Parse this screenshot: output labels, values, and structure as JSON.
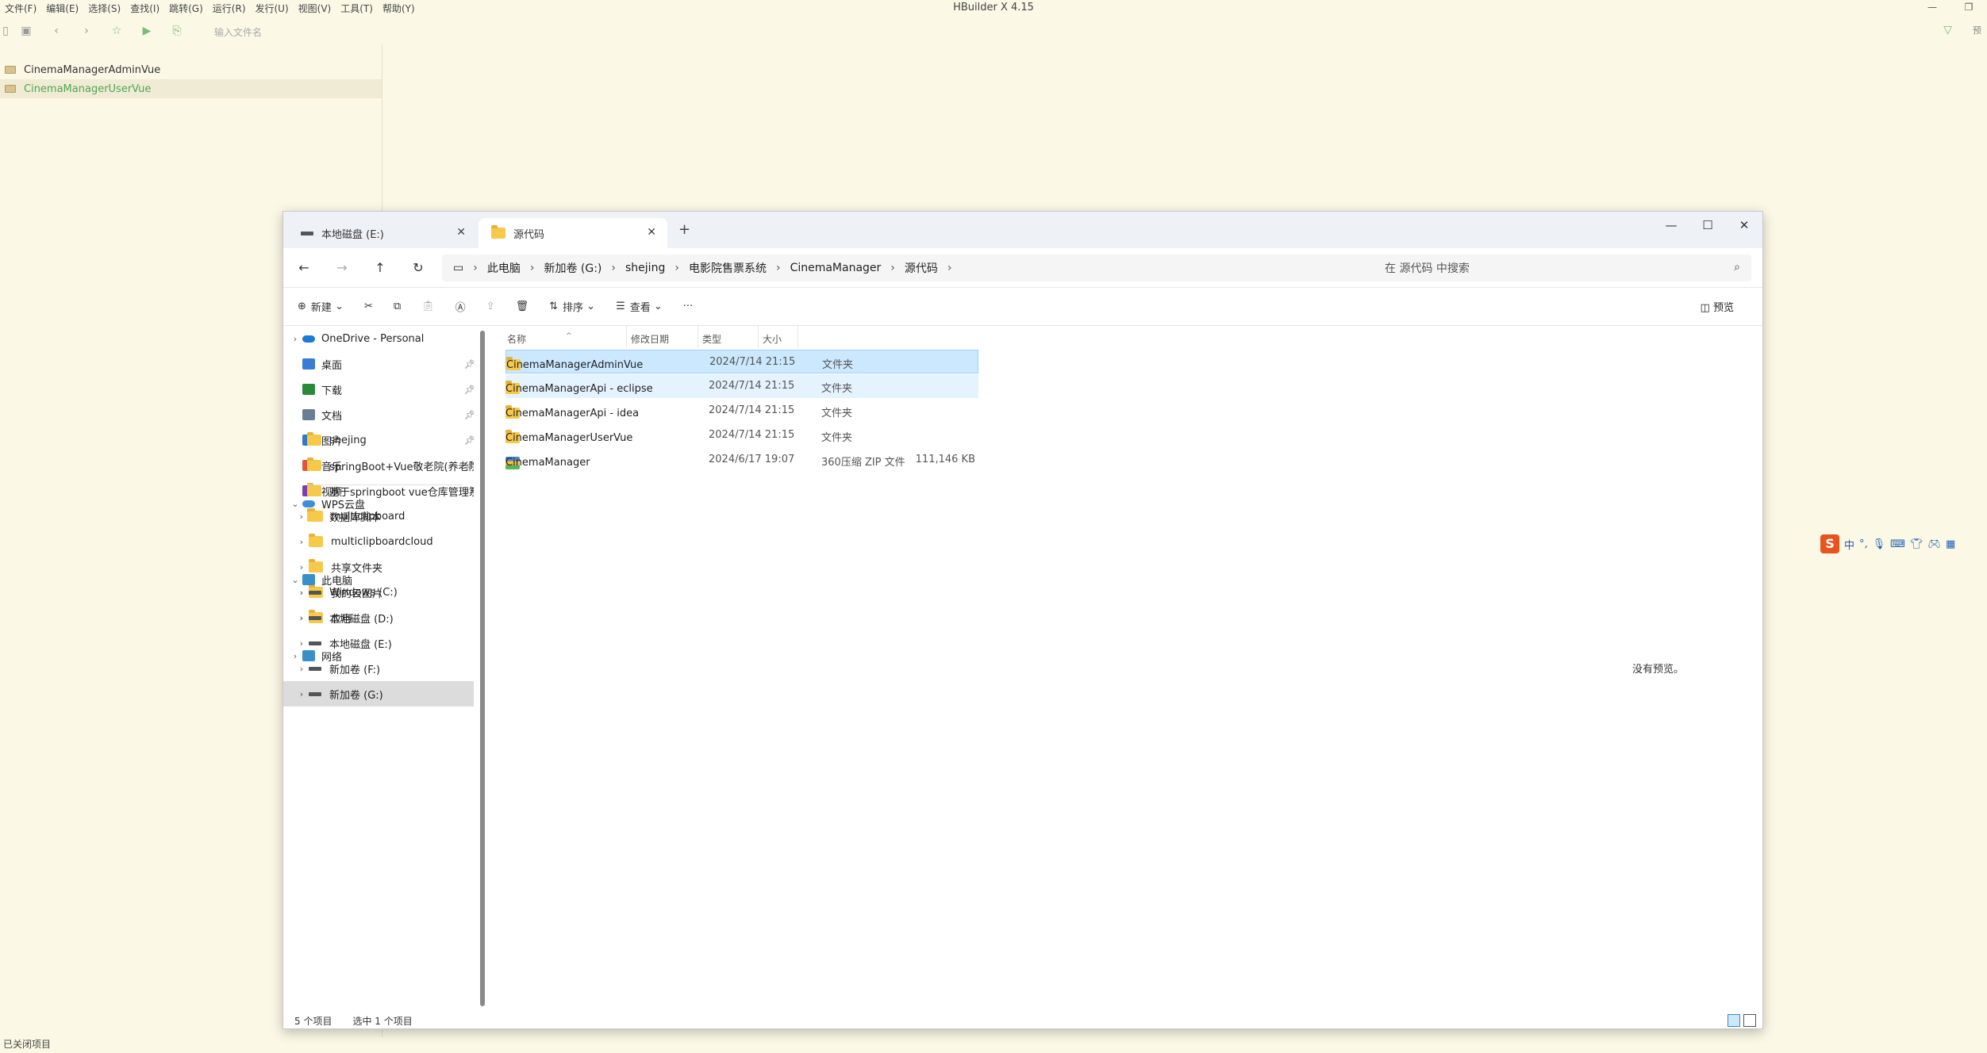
{
  "hbuilder": {
    "title": "HBuilder X 4.15",
    "menu": [
      "文件(F)",
      "编辑(E)",
      "选择(S)",
      "查找(I)",
      "跳转(G)",
      "运行(R)",
      "发行(U)",
      "视图(V)",
      "工具(T)",
      "帮助(Y)"
    ],
    "file_input_placeholder": "输入文件名",
    "preview_edge": "预",
    "projects": [
      "CinemaManagerAdminVue",
      "CinemaManagerUserVue"
    ],
    "status": "已关闭项目"
  },
  "explorer": {
    "tabs": [
      {
        "label": "本地磁盘 (E:)",
        "icon": "drive-icon"
      },
      {
        "label": "源代码",
        "icon": "folder-icon"
      }
    ],
    "breadcrumb": [
      "此电脑",
      "新加卷 (G:)",
      "shejing",
      "电影院售票系统",
      "CinemaManager",
      "源代码"
    ],
    "search_placeholder": "在 源代码 中搜索",
    "commands": {
      "new": "新建",
      "sort": "排序",
      "view": "查看",
      "more": "···",
      "preview": "预览"
    },
    "nav": {
      "onedrive": "OneDrive - Personal",
      "quick": [
        {
          "label": "桌面",
          "icon": "desktop-icon",
          "color": "#3a7bd5"
        },
        {
          "label": "下载",
          "icon": "download-icon",
          "color": "#2a8a3a"
        },
        {
          "label": "文档",
          "icon": "document-icon",
          "color": "#6a7f95"
        },
        {
          "label": "图片",
          "icon": "picture-icon",
          "color": "#2f79c6"
        },
        {
          "label": "音乐",
          "icon": "music-icon",
          "color": "#e0553a"
        },
        {
          "label": "视频",
          "icon": "video-icon",
          "color": "#7b3fb3"
        }
      ],
      "folders": [
        "shejing",
        "springBoot+Vue敬老院(养老院)管",
        "基于springboot vue仓库管理系统",
        "数据库脚本"
      ],
      "wps": "WPS云盘",
      "wps_items": [
        "multiclipboard",
        "multiclipboardcloud",
        "共享文件夹",
        "我的云图片",
        "应用"
      ],
      "pc": "此电脑",
      "drives": [
        "Windows (C:)",
        "本地磁盘 (D:)",
        "本地磁盘 (E:)",
        "新加卷 (F:)",
        "新加卷 (G:)"
      ],
      "network": "网络"
    },
    "columns": [
      "名称",
      "修改日期",
      "类型",
      "大小"
    ],
    "files": [
      {
        "name": "CinemaManagerAdminVue",
        "date": "2024/7/14 21:15",
        "type": "文件夹",
        "size": ""
      },
      {
        "name": "CinemaManagerApi - eclipse",
        "date": "2024/7/14 21:15",
        "type": "文件夹",
        "size": ""
      },
      {
        "name": "CinemaManagerApi - idea",
        "date": "2024/7/14 21:15",
        "type": "文件夹",
        "size": ""
      },
      {
        "name": "CinemaManagerUserVue",
        "date": "2024/7/14 21:15",
        "type": "文件夹",
        "size": ""
      },
      {
        "name": "CinemaManager",
        "date": "2024/6/17 19:07",
        "type": "360压缩 ZIP 文件",
        "size": "111,146 KB"
      }
    ],
    "no_preview": "没有预览。",
    "status_count": "5 个项目",
    "status_selected": "选中 1 个项目"
  },
  "ime": {
    "lang": "中"
  }
}
